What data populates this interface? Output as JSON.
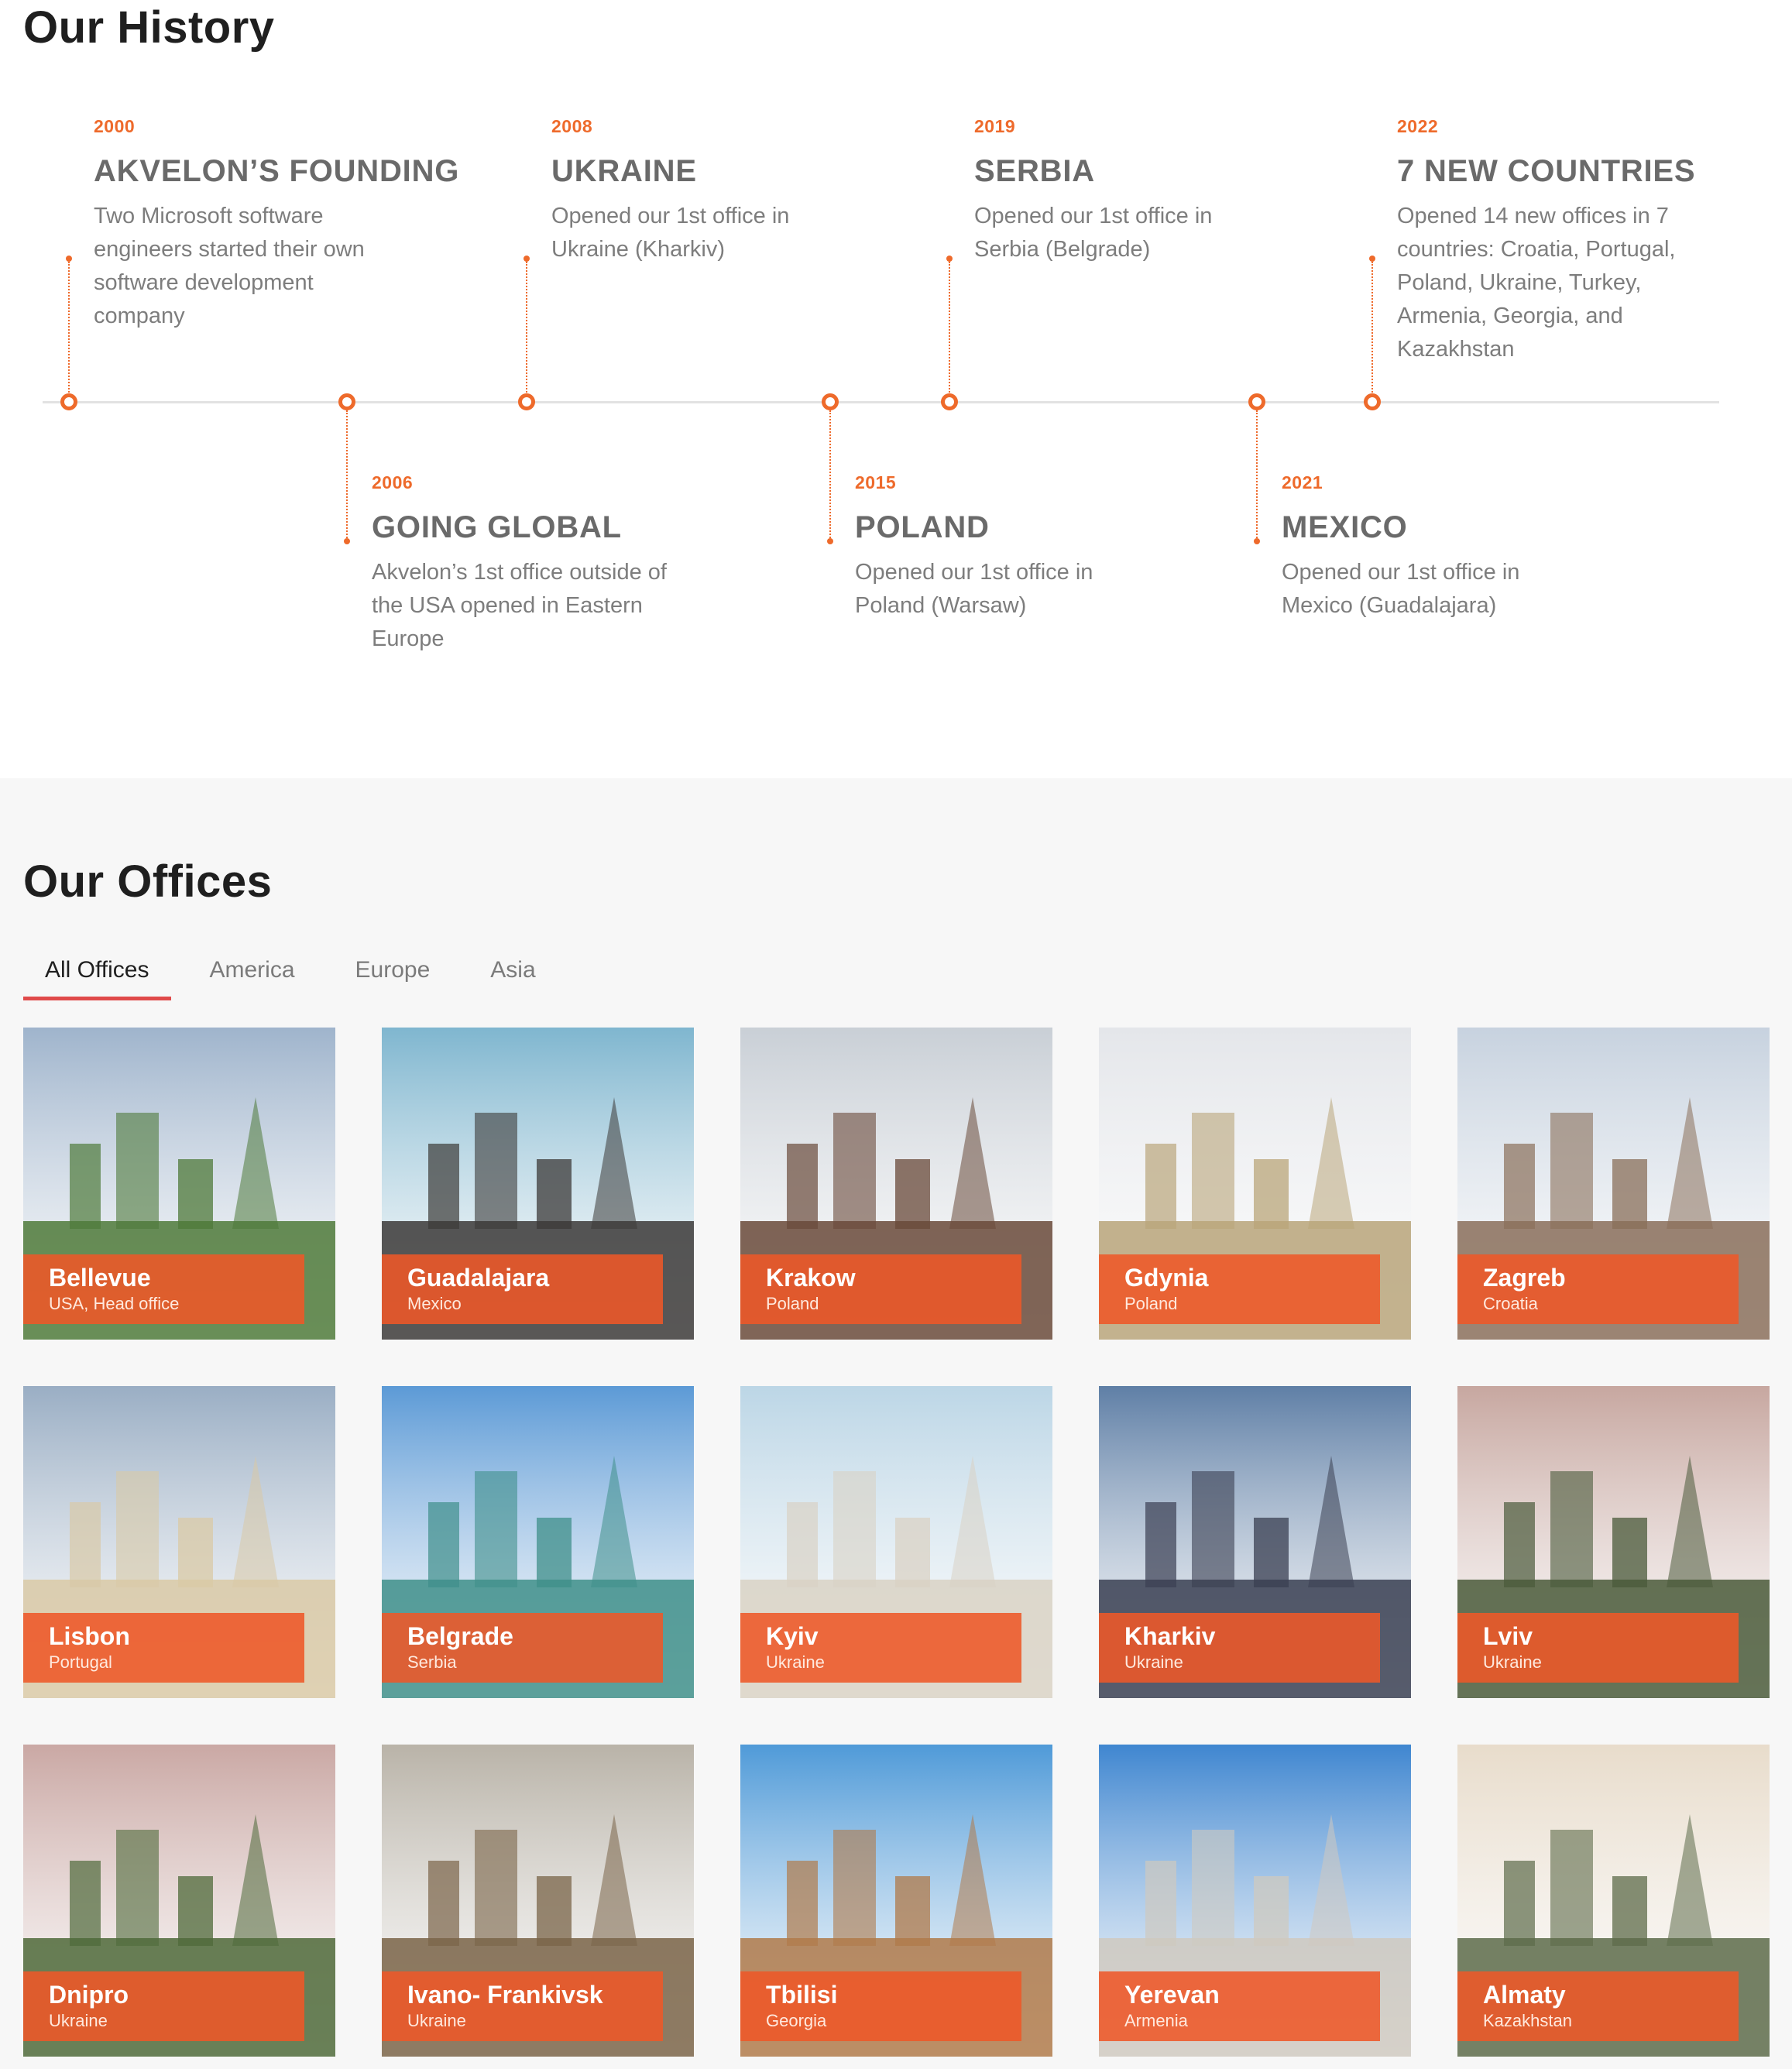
{
  "history": {
    "title": "Our History",
    "events": [
      {
        "year": "2000",
        "title": "AKVELON’S FOUNDING",
        "desc": "Two Microsoft software engineers started their own software development company"
      },
      {
        "year": "2006",
        "title": "GOING GLOBAL",
        "desc": "Akvelon’s 1st office outside of the USA opened in Eastern Europe"
      },
      {
        "year": "2008",
        "title": "UKRAINE",
        "desc": "Opened our 1st office in Ukraine (Kharkiv)"
      },
      {
        "year": "2015",
        "title": "POLAND",
        "desc": "Opened our 1st office in Poland (Warsaw)"
      },
      {
        "year": "2019",
        "title": "SERBIA",
        "desc": "Opened our 1st office in Serbia (Belgrade)"
      },
      {
        "year": "2021",
        "title": "MEXICO",
        "desc": "Opened our 1st office in Mexico (Guadalajara)"
      },
      {
        "year": "2022",
        "title": "7 NEW COUNTRIES",
        "desc": "Opened 14 new offices in 7 countries: Croatia, Portugal, Poland, Ukraine, Turkey, Armenia, Georgia, and Kazakhstan"
      }
    ]
  },
  "offices": {
    "title": "Our Offices",
    "tabs": [
      "All Offices",
      "America",
      "Europe",
      "Asia"
    ],
    "active_tab": "All Offices",
    "cards": [
      {
        "city": "Bellevue",
        "country": "USA, Head office",
        "sky": "#9fb4cc",
        "ground": "#4f7a3a"
      },
      {
        "city": "Guadalajara",
        "country": "Mexico",
        "sky": "#7fb6cf",
        "ground": "#3c3a38"
      },
      {
        "city": "Krakow",
        "country": "Poland",
        "sky": "#c9cfd6",
        "ground": "#6a4a3a"
      },
      {
        "city": "Gdynia",
        "country": "Poland",
        "sky": "#e4e6ea",
        "ground": "#b9a57a"
      },
      {
        "city": "Zagreb",
        "country": "Croatia",
        "sky": "#c7d2df",
        "ground": "#8a6f5a"
      },
      {
        "city": "Lisbon",
        "country": "Portugal",
        "sky": "#9aaec4",
        "ground": "#d9c9a6"
      },
      {
        "city": "Belgrade",
        "country": "Serbia",
        "sky": "#5c9ad6",
        "ground": "#3f8f8a"
      },
      {
        "city": "Kyiv",
        "country": "Ukraine",
        "sky": "#bcd6e6",
        "ground": "#d9d2c4"
      },
      {
        "city": "Kharkiv",
        "country": "Ukraine",
        "sky": "#5f7fa6",
        "ground": "#3a3f52"
      },
      {
        "city": "Lviv",
        "country": "Ukraine",
        "sky": "#c7a7a0",
        "ground": "#4a5a3a"
      },
      {
        "city": "Dnipro",
        "country": "Ukraine",
        "sky": "#caa8a4",
        "ground": "#4f6a3a"
      },
      {
        "city": "Ivano- Frankivsk",
        "country": "Ukraine",
        "sky": "#b9b3a8",
        "ground": "#7a6448"
      },
      {
        "city": "Tbilisi",
        "country": "Georgia",
        "sky": "#4f9ad8",
        "ground": "#b07a4a"
      },
      {
        "city": "Yerevan",
        "country": "Armenia",
        "sky": "#3f86d0",
        "ground": "#cfc9bf"
      },
      {
        "city": "Almaty",
        "country": "Kazakhstan",
        "sky": "#e8dccb",
        "ground": "#5d6b4a"
      }
    ]
  },
  "colors": {
    "accent": "#ee6a2b",
    "tab_underline": "#e04a4a",
    "caption": "#ee5828"
  }
}
